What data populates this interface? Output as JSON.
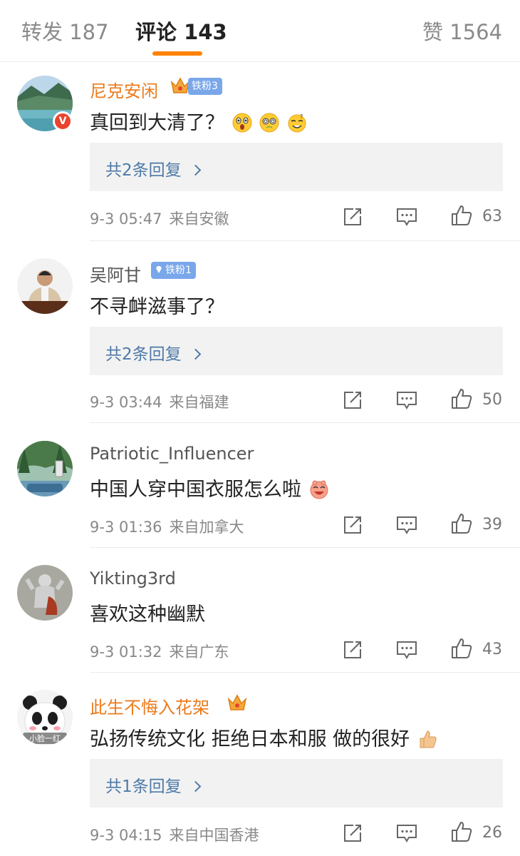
{
  "tabs": {
    "forward_label": "转发 187",
    "comments_label": "评论 143",
    "likes_label": "赞 1564"
  },
  "comments": [
    {
      "username": "尼克安闲",
      "badge": "铁粉3",
      "verified_mark": "V",
      "text": "真回到大清了？",
      "emojis": [
        "astonished-emoji",
        "dizzy-eyes-emoji",
        "sweat-smile-emoji"
      ],
      "reply": "共2条回复",
      "date": "9-3 05:47",
      "location": "来自安徽",
      "likes": "63"
    },
    {
      "username": "吴阿甘",
      "badge": "铁粉1",
      "text": "不寻衅滋事了？",
      "reply": "共2条回复",
      "date": "9-3 03:44",
      "location": "来自福建",
      "likes": "50"
    },
    {
      "username": "Patriotic_Influencer",
      "text": "中国人穿中国衣服怎么啦",
      "emojis": [
        "laughing-pig-emoji"
      ],
      "date": "9-3 01:36",
      "location": "来自加拿大",
      "likes": "39"
    },
    {
      "username": "Yikting3rd",
      "text": "喜欢这种幽默",
      "date": "9-3 01:32",
      "location": "来自广东",
      "likes": "43"
    },
    {
      "username": "此生不悔入花架",
      "avatar_text": "小脸一红",
      "text": "弘扬传统文化 拒绝日本和服  做的很好",
      "emojis": [
        "thumbs-up-emoji"
      ],
      "reply": "共1条回复",
      "date": "9-3 04:15",
      "location": "来自中国香港",
      "likes": "26"
    }
  ],
  "colors": {
    "accent": "#ff8200",
    "vip_name": "#eb7b1c",
    "reply_link": "#4e7aa8",
    "fan_badge": "#7aa7ea"
  },
  "icons": {
    "repost": "repost-icon",
    "comment": "comment-icon",
    "like": "like-icon"
  }
}
